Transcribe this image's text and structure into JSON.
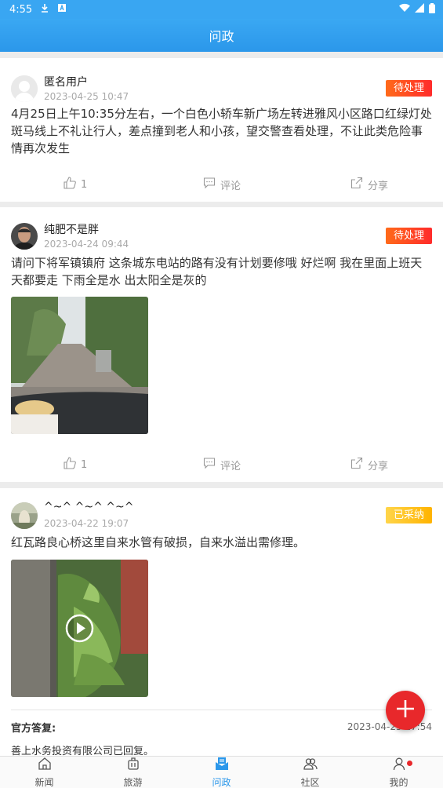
{
  "status_bar": {
    "time": "4:55"
  },
  "app_bar": {
    "title": "问政"
  },
  "posts": [
    {
      "user": "匿名用户",
      "date": "2023-04-25 10:47",
      "status": "待处理",
      "content": "4月25日上午10:35分左右，一个白色小轿车新广场左转进雅风小区路口红绿灯处斑马线上不礼让行人，差点撞到老人和小孩，望交警查看处理，不让此类危险事情再次发生",
      "likes": "1",
      "comment_label": "评论",
      "share_label": "分享"
    },
    {
      "user": "纯肥不是胖",
      "date": "2023-04-24 09:44",
      "status": "待处理",
      "content": "请问下将军镇镇府 这条城东电站的路有没有计划要修哦 好烂啊 我在里面上班天天都要走 下雨全是水 出太阳全是灰的",
      "likes": "1",
      "comment_label": "评论",
      "share_label": "分享"
    },
    {
      "user": "^~^ ^~^ ^~^",
      "date": "2023-04-22 19:07",
      "status": "已采纳",
      "content": "红瓦路良心桥这里自来水管有破损，自来水溢出需修理。",
      "reply_label": "官方答复:",
      "reply_time": "2023-04-25 17:54",
      "reply_text": "善上水务投资有限公司已回复。"
    }
  ],
  "tabs": [
    {
      "label": "新闻",
      "icon": "home-icon"
    },
    {
      "label": "旅游",
      "icon": "luggage-icon"
    },
    {
      "label": "问政",
      "icon": "mail-icon"
    },
    {
      "label": "社区",
      "icon": "community-icon"
    },
    {
      "label": "我的",
      "icon": "person-icon"
    }
  ],
  "colors": {
    "primary": "#2b97ea",
    "pending": "#ff3d24",
    "adopted": "#ffc107",
    "fab": "#e8282b"
  }
}
